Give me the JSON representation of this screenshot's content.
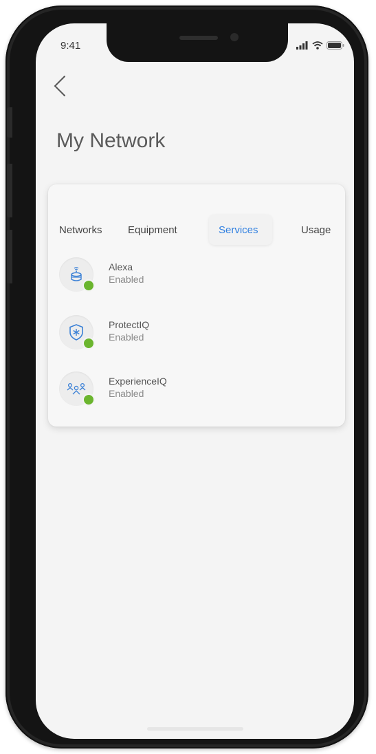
{
  "status_bar": {
    "time": "9:41"
  },
  "header": {
    "back_icon": "chevron-left-icon",
    "title": "My Network"
  },
  "tabs": [
    {
      "label": "Networks",
      "active": false
    },
    {
      "label": "Equipment",
      "active": false
    },
    {
      "label": "Services",
      "active": true
    },
    {
      "label": "Usage",
      "active": false
    }
  ],
  "services": [
    {
      "name": "Alexa",
      "status": "Enabled",
      "icon": "alexa-device-icon"
    },
    {
      "name": "ProtectIQ",
      "status": "Enabled",
      "icon": "shield-icon"
    },
    {
      "name": "ExperienceIQ",
      "status": "Enabled",
      "icon": "people-icon"
    }
  ],
  "colors": {
    "accent": "#2f7fe0",
    "enabled_dot": "#6bb52e",
    "screen_bg": "#f4f4f4",
    "phone_frame": "#252525"
  }
}
